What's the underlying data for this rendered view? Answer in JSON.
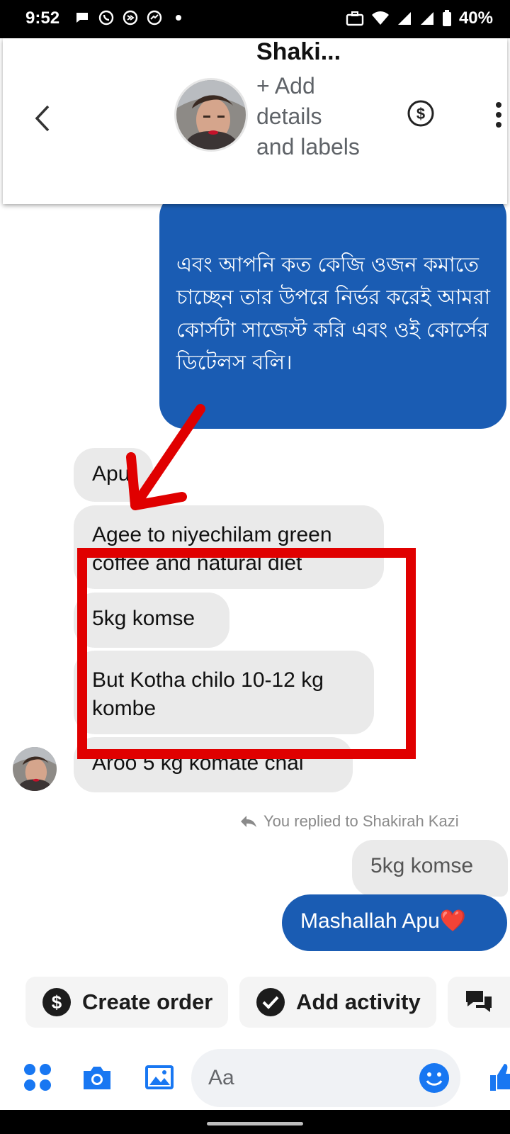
{
  "status_bar": {
    "time": "9:52",
    "battery": "40%"
  },
  "header": {
    "contact_name": "Shaki...",
    "add_details": "+ Add details and labels",
    "icons": [
      "back-icon",
      "dollar-icon",
      "more-vert-icon"
    ]
  },
  "messages": {
    "outgoing_long": "এবং আপনি কত কেজি ওজন কমাতে চাচ্ছেন তার উপরে নির্ভর করেই আমরা কোর্সটা সাজেস্ট করি এবং ওই কোর্সের ডিটেলস বলি।",
    "incoming": [
      "Apu",
      "Agee to niyechilam green coffee and natural diet",
      "5kg komse",
      "But Kotha chilo 10-12 kg kombe",
      "Aroo 5 kg komate chai"
    ],
    "replied_note": "You replied to Shakirah Kazi",
    "reply_quote": "5kg komse",
    "outgoing_last": "Mashallah Apu",
    "outgoing_last_emoji": "❤️"
  },
  "actions": {
    "create_order": "Create order",
    "add_activity": "Add activity"
  },
  "composer": {
    "placeholder": "Aa"
  },
  "colors": {
    "brand_blue": "#1a5cb3",
    "messenger_blue": "#1877f2",
    "incoming_bubble": "#eaeaea",
    "annotation_red": "#e00000"
  }
}
